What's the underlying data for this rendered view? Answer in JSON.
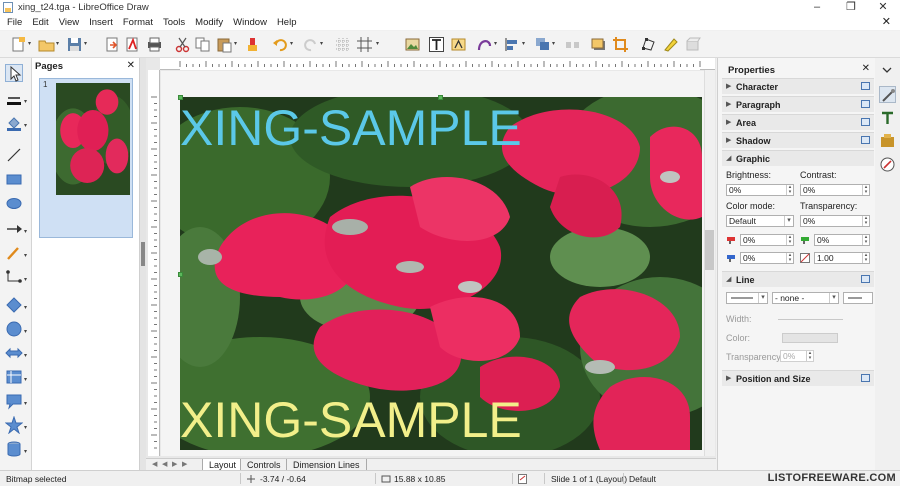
{
  "window": {
    "title": "xing_t24.tga - LibreOffice Draw",
    "minimize_glyph": "–",
    "restore_glyph": "❐",
    "close_glyph": "✕"
  },
  "menubar": {
    "items": [
      {
        "label": "File"
      },
      {
        "label": "Edit"
      },
      {
        "label": "View"
      },
      {
        "label": "Insert"
      },
      {
        "label": "Format"
      },
      {
        "label": "Tools"
      },
      {
        "label": "Modify"
      },
      {
        "label": "Window"
      },
      {
        "label": "Help"
      }
    ],
    "close_glyph": "✕"
  },
  "toolbar": {
    "icons": [
      "new-icon",
      "open-icon",
      "save-icon",
      "export-icon",
      "export-pdf-icon",
      "print-icon",
      "cut-icon",
      "copy-icon",
      "paste-icon",
      "clone-formatting-icon",
      "undo-icon",
      "redo-icon",
      "grid-icon",
      "helplines-icon",
      "image-icon",
      "textbox-icon",
      "fontwork-icon",
      "curve-icon",
      "align-icon",
      "arrange-icon",
      "distribute-icon",
      "shadow-icon",
      "crop-icon",
      "points-icon",
      "glue-icon",
      "toggle-extrusion-icon"
    ]
  },
  "pages_pane": {
    "title": "Pages",
    "close_glyph": "✕",
    "thumbnail_number": "1"
  },
  "image": {
    "top_text": "XING-SAMPLE",
    "bottom_text": "XING-SAMPLE",
    "top_text_color": "#5bc8e8",
    "bottom_text_color": "#f2ef8a"
  },
  "sheet_tabs": [
    {
      "label": "Layout",
      "active": true
    },
    {
      "label": "Controls",
      "active": false
    },
    {
      "label": "Dimension Lines",
      "active": false
    }
  ],
  "properties": {
    "title": "Properties",
    "close_glyph": "✕",
    "sections": {
      "character": "Character",
      "paragraph": "Paragraph",
      "area": "Area",
      "shadow": "Shadow",
      "graphic": "Graphic",
      "line": "Line",
      "position_size": "Position and Size"
    },
    "graphic": {
      "brightness_label": "Brightness:",
      "brightness_value": "0%",
      "contrast_label": "Contrast:",
      "contrast_value": "0%",
      "color_mode_label": "Color mode:",
      "color_mode_value": "Default",
      "transparency_label": "Transparency:",
      "transparency_value": "0%",
      "red_value": "0%",
      "green_value": "0%",
      "blue_value": "0%",
      "gamma_value": "1.00"
    },
    "line": {
      "style_value": "- none -",
      "width_label": "Width:",
      "color_label": "Color:",
      "transparency_label": "Transparency:",
      "transparency_value": "0%"
    }
  },
  "statusbar": {
    "mode": "Bitmap selected",
    "position": "-3.74 / -0.64",
    "size": "15.88 x 10.85",
    "slide": "Slide 1 of 1 (Layout)",
    "master": "Default",
    "watermark": "LISTOFREEWARE.COM"
  },
  "colors": {
    "accent": "#4a76b0",
    "selection_handle": "#5cb85c"
  }
}
